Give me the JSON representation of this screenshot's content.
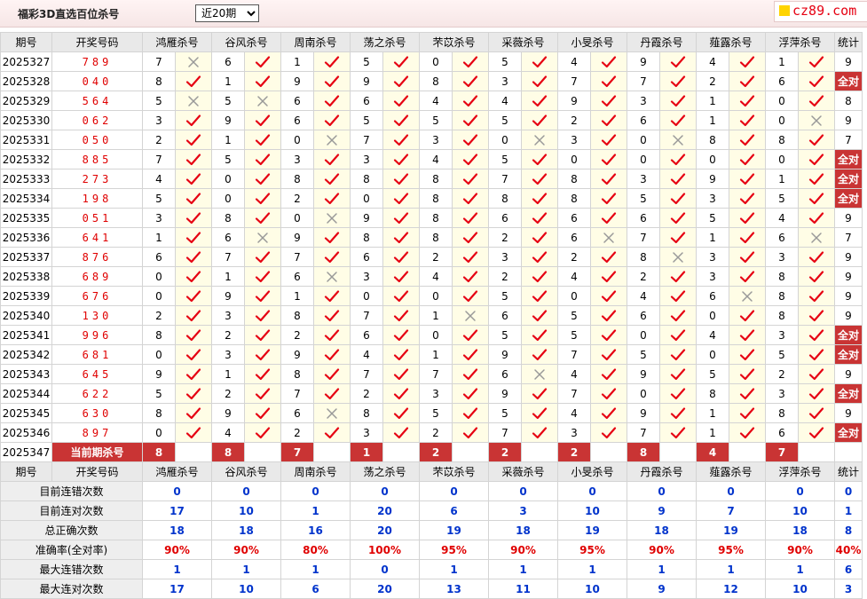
{
  "header": {
    "title": "福彩3D直选百位杀号",
    "period_select": "近20期",
    "logo_text": "cz89.com"
  },
  "columns": {
    "period": "期号",
    "draw": "开奖号码",
    "experts": [
      "鸿雁杀号",
      "谷风杀号",
      "周南杀号",
      "荡之杀号",
      "芣苡杀号",
      "采薇杀号",
      "小旻杀号",
      "丹霞杀号",
      "薤露杀号",
      "浮萍杀号"
    ],
    "stat": "统计"
  },
  "rows": [
    {
      "period": "2025327",
      "draw": "789",
      "kills": [
        [
          7,
          0
        ],
        [
          6,
          1
        ],
        [
          1,
          1
        ],
        [
          5,
          1
        ],
        [
          0,
          1
        ],
        [
          5,
          1
        ],
        [
          4,
          1
        ],
        [
          9,
          1
        ],
        [
          4,
          1
        ],
        [
          1,
          1
        ]
      ],
      "stat": "9"
    },
    {
      "period": "2025328",
      "draw": "040",
      "kills": [
        [
          8,
          1
        ],
        [
          1,
          1
        ],
        [
          9,
          1
        ],
        [
          9,
          1
        ],
        [
          8,
          1
        ],
        [
          3,
          1
        ],
        [
          7,
          1
        ],
        [
          7,
          1
        ],
        [
          2,
          1
        ],
        [
          6,
          1
        ]
      ],
      "stat": "全对"
    },
    {
      "period": "2025329",
      "draw": "564",
      "kills": [
        [
          5,
          0
        ],
        [
          5,
          0
        ],
        [
          6,
          1
        ],
        [
          6,
          1
        ],
        [
          4,
          1
        ],
        [
          4,
          1
        ],
        [
          9,
          1
        ],
        [
          3,
          1
        ],
        [
          1,
          1
        ],
        [
          0,
          1
        ]
      ],
      "stat": "8"
    },
    {
      "period": "2025330",
      "draw": "062",
      "kills": [
        [
          3,
          1
        ],
        [
          9,
          1
        ],
        [
          6,
          1
        ],
        [
          5,
          1
        ],
        [
          5,
          1
        ],
        [
          5,
          1
        ],
        [
          2,
          1
        ],
        [
          6,
          1
        ],
        [
          1,
          1
        ],
        [
          0,
          0
        ]
      ],
      "stat": "9"
    },
    {
      "period": "2025331",
      "draw": "050",
      "kills": [
        [
          2,
          1
        ],
        [
          1,
          1
        ],
        [
          0,
          0
        ],
        [
          7,
          1
        ],
        [
          3,
          1
        ],
        [
          0,
          0
        ],
        [
          3,
          1
        ],
        [
          0,
          0
        ],
        [
          8,
          1
        ],
        [
          8,
          1
        ]
      ],
      "stat": "7"
    },
    {
      "period": "2025332",
      "draw": "885",
      "kills": [
        [
          7,
          1
        ],
        [
          5,
          1
        ],
        [
          3,
          1
        ],
        [
          3,
          1
        ],
        [
          4,
          1
        ],
        [
          5,
          1
        ],
        [
          0,
          1
        ],
        [
          0,
          1
        ],
        [
          0,
          1
        ],
        [
          0,
          1
        ]
      ],
      "stat": "全对"
    },
    {
      "period": "2025333",
      "draw": "273",
      "kills": [
        [
          4,
          1
        ],
        [
          0,
          1
        ],
        [
          8,
          1
        ],
        [
          8,
          1
        ],
        [
          8,
          1
        ],
        [
          7,
          1
        ],
        [
          8,
          1
        ],
        [
          3,
          1
        ],
        [
          9,
          1
        ],
        [
          1,
          1
        ]
      ],
      "stat": "全对"
    },
    {
      "period": "2025334",
      "draw": "198",
      "kills": [
        [
          5,
          1
        ],
        [
          0,
          1
        ],
        [
          2,
          1
        ],
        [
          0,
          1
        ],
        [
          8,
          1
        ],
        [
          8,
          1
        ],
        [
          8,
          1
        ],
        [
          5,
          1
        ],
        [
          3,
          1
        ],
        [
          5,
          1
        ]
      ],
      "stat": "全对"
    },
    {
      "period": "2025335",
      "draw": "051",
      "kills": [
        [
          3,
          1
        ],
        [
          8,
          1
        ],
        [
          0,
          0
        ],
        [
          9,
          1
        ],
        [
          8,
          1
        ],
        [
          6,
          1
        ],
        [
          6,
          1
        ],
        [
          6,
          1
        ],
        [
          5,
          1
        ],
        [
          4,
          1
        ]
      ],
      "stat": "9"
    },
    {
      "period": "2025336",
      "draw": "641",
      "kills": [
        [
          1,
          1
        ],
        [
          6,
          0
        ],
        [
          9,
          1
        ],
        [
          8,
          1
        ],
        [
          8,
          1
        ],
        [
          2,
          1
        ],
        [
          6,
          0
        ],
        [
          7,
          1
        ],
        [
          1,
          1
        ],
        [
          6,
          0
        ]
      ],
      "stat": "7"
    },
    {
      "period": "2025337",
      "draw": "876",
      "kills": [
        [
          6,
          1
        ],
        [
          7,
          1
        ],
        [
          7,
          1
        ],
        [
          6,
          1
        ],
        [
          2,
          1
        ],
        [
          3,
          1
        ],
        [
          2,
          1
        ],
        [
          8,
          0
        ],
        [
          3,
          1
        ],
        [
          3,
          1
        ]
      ],
      "stat": "9"
    },
    {
      "period": "2025338",
      "draw": "689",
      "kills": [
        [
          0,
          1
        ],
        [
          1,
          1
        ],
        [
          6,
          0
        ],
        [
          3,
          1
        ],
        [
          4,
          1
        ],
        [
          2,
          1
        ],
        [
          4,
          1
        ],
        [
          2,
          1
        ],
        [
          3,
          1
        ],
        [
          8,
          1
        ]
      ],
      "stat": "9"
    },
    {
      "period": "2025339",
      "draw": "676",
      "kills": [
        [
          0,
          1
        ],
        [
          9,
          1
        ],
        [
          1,
          1
        ],
        [
          0,
          1
        ],
        [
          0,
          1
        ],
        [
          5,
          1
        ],
        [
          0,
          1
        ],
        [
          4,
          1
        ],
        [
          6,
          0
        ],
        [
          8,
          1
        ]
      ],
      "stat": "9"
    },
    {
      "period": "2025340",
      "draw": "130",
      "kills": [
        [
          2,
          1
        ],
        [
          3,
          1
        ],
        [
          8,
          1
        ],
        [
          7,
          1
        ],
        [
          1,
          0
        ],
        [
          6,
          1
        ],
        [
          5,
          1
        ],
        [
          6,
          1
        ],
        [
          0,
          1
        ],
        [
          8,
          1
        ]
      ],
      "stat": "9"
    },
    {
      "period": "2025341",
      "draw": "996",
      "kills": [
        [
          8,
          1
        ],
        [
          2,
          1
        ],
        [
          2,
          1
        ],
        [
          6,
          1
        ],
        [
          0,
          1
        ],
        [
          5,
          1
        ],
        [
          5,
          1
        ],
        [
          0,
          1
        ],
        [
          4,
          1
        ],
        [
          3,
          1
        ]
      ],
      "stat": "全对"
    },
    {
      "period": "2025342",
      "draw": "681",
      "kills": [
        [
          0,
          1
        ],
        [
          3,
          1
        ],
        [
          9,
          1
        ],
        [
          4,
          1
        ],
        [
          1,
          1
        ],
        [
          9,
          1
        ],
        [
          7,
          1
        ],
        [
          5,
          1
        ],
        [
          0,
          1
        ],
        [
          5,
          1
        ]
      ],
      "stat": "全对"
    },
    {
      "period": "2025343",
      "draw": "645",
      "kills": [
        [
          9,
          1
        ],
        [
          1,
          1
        ],
        [
          8,
          1
        ],
        [
          7,
          1
        ],
        [
          7,
          1
        ],
        [
          6,
          0
        ],
        [
          4,
          1
        ],
        [
          9,
          1
        ],
        [
          5,
          1
        ],
        [
          2,
          1
        ]
      ],
      "stat": "9"
    },
    {
      "period": "2025344",
      "draw": "622",
      "kills": [
        [
          5,
          1
        ],
        [
          2,
          1
        ],
        [
          7,
          1
        ],
        [
          2,
          1
        ],
        [
          3,
          1
        ],
        [
          9,
          1
        ],
        [
          7,
          1
        ],
        [
          0,
          1
        ],
        [
          8,
          1
        ],
        [
          3,
          1
        ]
      ],
      "stat": "全对"
    },
    {
      "period": "2025345",
      "draw": "630",
      "kills": [
        [
          8,
          1
        ],
        [
          9,
          1
        ],
        [
          6,
          0
        ],
        [
          8,
          1
        ],
        [
          5,
          1
        ],
        [
          5,
          1
        ],
        [
          4,
          1
        ],
        [
          9,
          1
        ],
        [
          1,
          1
        ],
        [
          8,
          1
        ]
      ],
      "stat": "9"
    },
    {
      "period": "2025346",
      "draw": "897",
      "kills": [
        [
          0,
          1
        ],
        [
          4,
          1
        ],
        [
          2,
          1
        ],
        [
          3,
          1
        ],
        [
          2,
          1
        ],
        [
          7,
          1
        ],
        [
          3,
          1
        ],
        [
          7,
          1
        ],
        [
          1,
          1
        ],
        [
          6,
          1
        ]
      ],
      "stat": "全对"
    }
  ],
  "current": {
    "period": "2025347",
    "label": "当前期杀号",
    "kills": [
      "8",
      "8",
      "7",
      "1",
      "2",
      "2",
      "2",
      "8",
      "4",
      "7"
    ]
  },
  "stats": [
    {
      "label": "目前连错次数",
      "values": [
        "0",
        "0",
        "0",
        "0",
        "0",
        "0",
        "0",
        "0",
        "0",
        "0"
      ],
      "stat": "0",
      "rate": false
    },
    {
      "label": "目前连对次数",
      "values": [
        "17",
        "10",
        "1",
        "20",
        "6",
        "3",
        "10",
        "9",
        "7",
        "10"
      ],
      "stat": "1",
      "rate": false
    },
    {
      "label": "总正确次数",
      "values": [
        "18",
        "18",
        "16",
        "20",
        "19",
        "18",
        "19",
        "18",
        "19",
        "18"
      ],
      "stat": "8",
      "rate": false
    },
    {
      "label": "准确率(全对率)",
      "values": [
        "90%",
        "90%",
        "80%",
        "100%",
        "95%",
        "90%",
        "95%",
        "90%",
        "95%",
        "90%"
      ],
      "stat": "40%",
      "rate": true
    },
    {
      "label": "最大连错次数",
      "values": [
        "1",
        "1",
        "1",
        "0",
        "1",
        "1",
        "1",
        "1",
        "1",
        "1"
      ],
      "stat": "6",
      "rate": false
    },
    {
      "label": "最大连对次数",
      "values": [
        "17",
        "10",
        "6",
        "20",
        "13",
        "11",
        "10",
        "9",
        "12",
        "10"
      ],
      "stat": "3",
      "rate": false
    }
  ],
  "colors": {
    "accent": "#c93434",
    "check": "#e60012",
    "cross": "#999999",
    "stat_blue": "#0033cc"
  },
  "icons": {
    "hit": "check-icon",
    "miss": "cross-icon"
  }
}
